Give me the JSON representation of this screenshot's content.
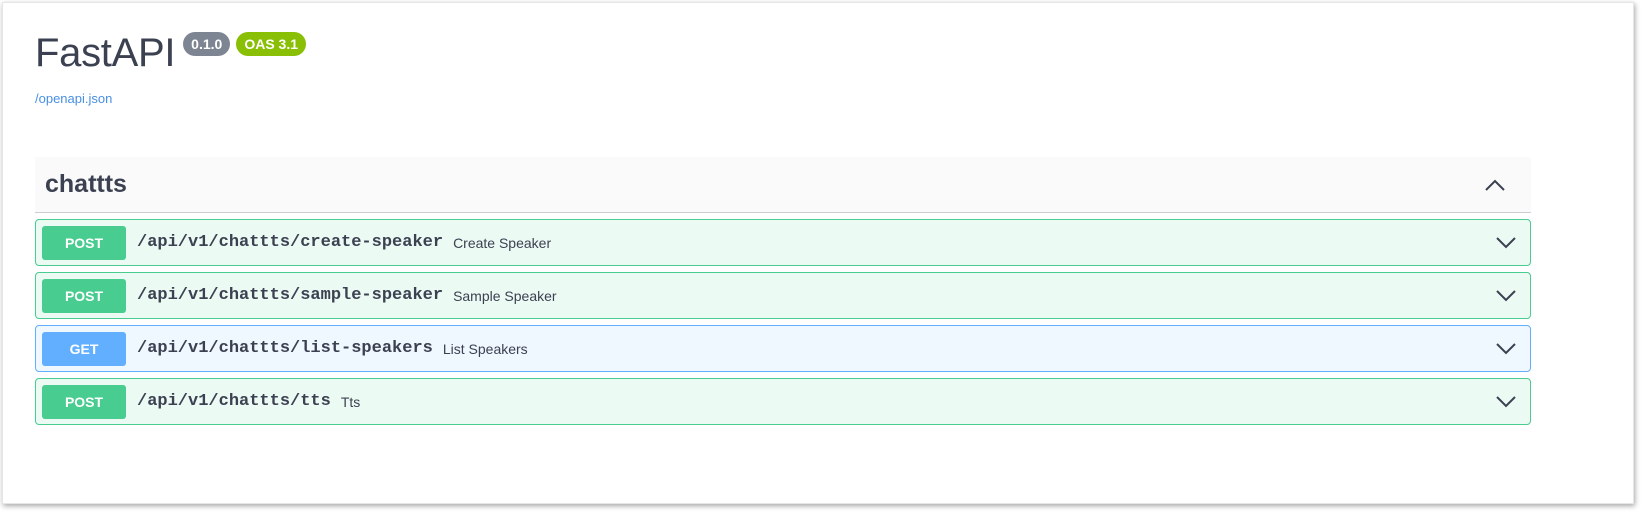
{
  "info": {
    "title": "FastAPI",
    "version": "0.1.0",
    "oas_version": "OAS 3.1",
    "spec_link": "/openapi.json"
  },
  "tag": {
    "name": "chattts"
  },
  "operations": [
    {
      "method": "POST",
      "path": "/api/v1/chattts/create-speaker",
      "summary": "Create Speaker"
    },
    {
      "method": "POST",
      "path": "/api/v1/chattts/sample-speaker",
      "summary": "Sample Speaker"
    },
    {
      "method": "GET",
      "path": "/api/v1/chattts/list-speakers",
      "summary": "List Speakers"
    },
    {
      "method": "POST",
      "path": "/api/v1/chattts/tts",
      "summary": "Tts"
    }
  ],
  "icons": {
    "collapse": "chevron-up-icon",
    "expand": "chevron-down-icon"
  },
  "colors": {
    "post": "#49cc90",
    "get": "#61affe",
    "version_badge": "#7d8492",
    "oas_badge": "#89bf04",
    "link": "#4990e2"
  }
}
